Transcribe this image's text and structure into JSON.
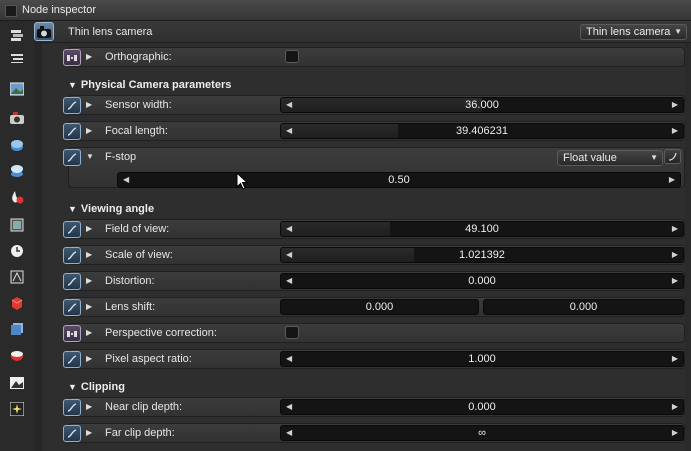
{
  "window": {
    "title": "Node inspector"
  },
  "toolbar": {
    "icons": [
      "layers-icon",
      "list-icon",
      "image-icon",
      "camera-icon",
      "geometry-icon",
      "environment-icon",
      "material-icon",
      "texture-icon",
      "clock-icon",
      "render-target-icon",
      "red-cube-icon",
      "blue-cube-icon",
      "mesh-icon",
      "display-icon",
      "effect-icon"
    ]
  },
  "header": {
    "node_label": "Thin lens camera",
    "type_select": "Thin lens camera"
  },
  "rows": {
    "orthographic": {
      "label": "Orthographic:"
    },
    "section_physical": "Physical Camera parameters",
    "sensor_width": {
      "label": "Sensor width:",
      "value": "36.000",
      "fill": 0.5
    },
    "focal_length": {
      "label": "Focal length:",
      "value": "39.406231",
      "fill": 0.4
    },
    "fstop": {
      "label": "F-stop",
      "mode_select": "Float value",
      "value": "0.50",
      "fill": 0.0
    },
    "section_viewing": "Viewing angle",
    "field_of_view": {
      "label": "Field of view:",
      "value": "49.100",
      "fill": 0.37
    },
    "scale_of_view": {
      "label": "Scale of view:",
      "value": "1.021392",
      "fill": 0.45
    },
    "distortion": {
      "label": "Distortion:",
      "value": "0.000",
      "fill": 0.0
    },
    "lens_shift": {
      "label": "Lens shift:",
      "value_x": "0.000",
      "value_y": "0.000"
    },
    "perspective_correction": {
      "label": "Perspective correction:"
    },
    "pixel_aspect_ratio": {
      "label": "Pixel aspect ratio:",
      "value": "1.000",
      "fill": 0.0
    },
    "section_clipping": "Clipping",
    "near_clip_depth": {
      "label": "Near clip depth:",
      "value": "0.000",
      "fill": 0.0
    },
    "far_clip_depth": {
      "label": "Far clip depth:",
      "value": "∞",
      "fill": 0.0
    }
  },
  "colors": {
    "pin_blue": "#8fb0cf",
    "pin_purple": "#b3a0c4",
    "slider_bg": "#141414"
  }
}
